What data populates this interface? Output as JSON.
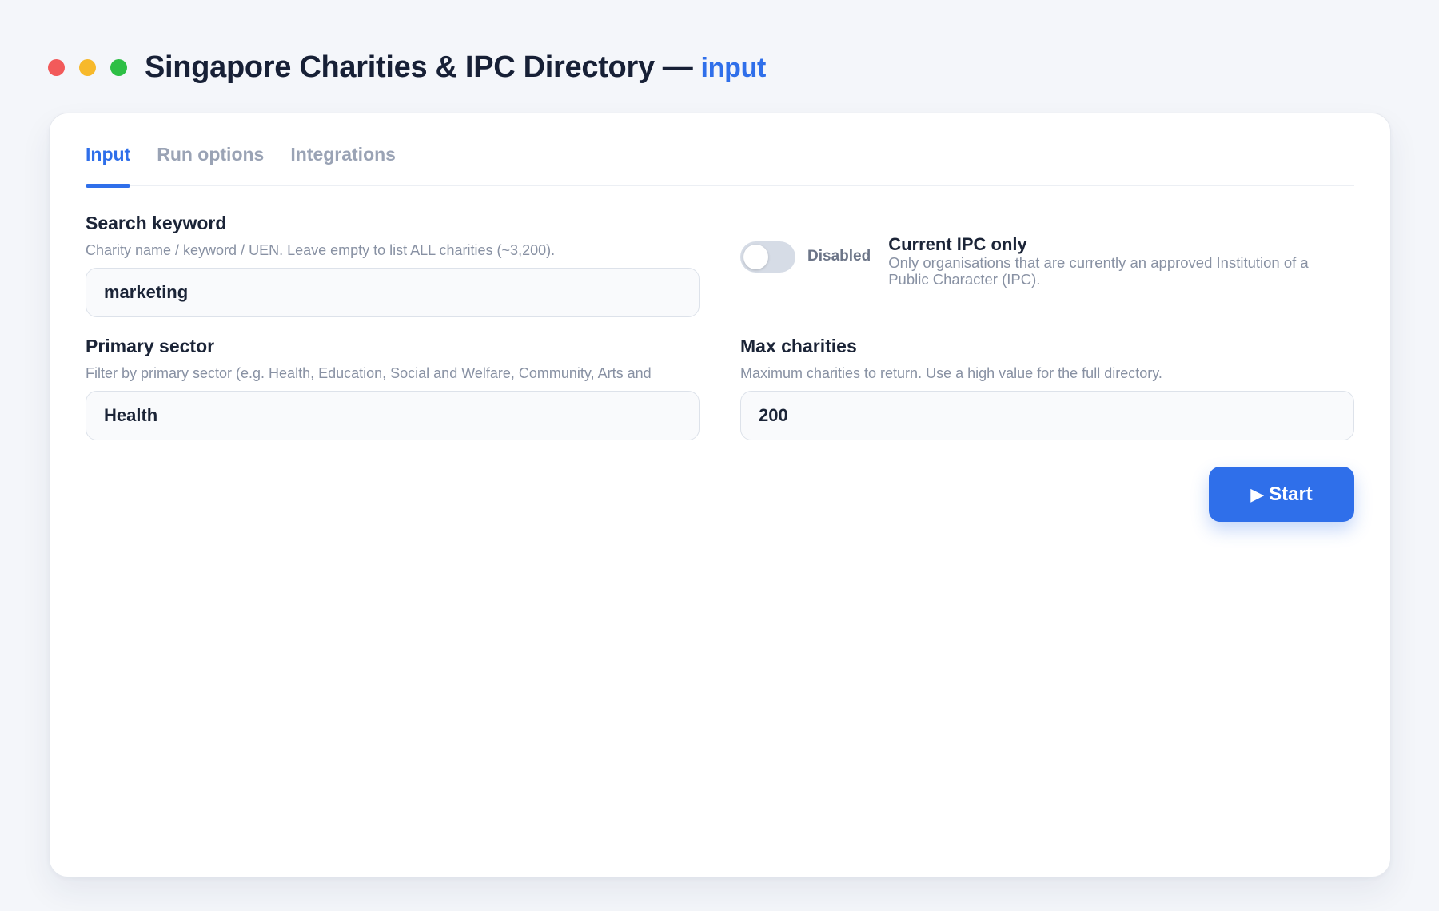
{
  "window": {
    "title": "Singapore Charities & IPC Directory",
    "separator": "—",
    "mode": "input",
    "controls": {
      "close_color": "#ff5f57",
      "minimize_color": "#febc2e",
      "zoom_color": "#28c840"
    }
  },
  "tabs": [
    {
      "label": "Input",
      "active": true
    },
    {
      "label": "Run options",
      "active": false
    },
    {
      "label": "Integrations",
      "active": false
    }
  ],
  "form": {
    "search_keyword": {
      "label": "Search keyword",
      "help": "Charity name / keyword / UEN. Leave empty to list ALL charities (~3,200).",
      "value": "marketing"
    },
    "current_ipc_only": {
      "state_label": "Disabled",
      "enabled": false,
      "title": "Current IPC only",
      "description": "Only organisations that are currently an approved Institution of a Public Character (IPC)."
    },
    "primary_sector": {
      "label": "Primary sector",
      "help": "Filter by primary sector (e.g. Health, Education, Social and Welfare, Community, Arts and",
      "value": "Health"
    },
    "max_charities": {
      "label": "Max charities",
      "help": "Maximum charities to return. Use a high value for the full directory.",
      "value": "200"
    }
  },
  "actions": {
    "start_icon": "▶",
    "start_label": "Start"
  },
  "colors": {
    "accent": "#2f6fea",
    "background": "#f4f6fa"
  }
}
